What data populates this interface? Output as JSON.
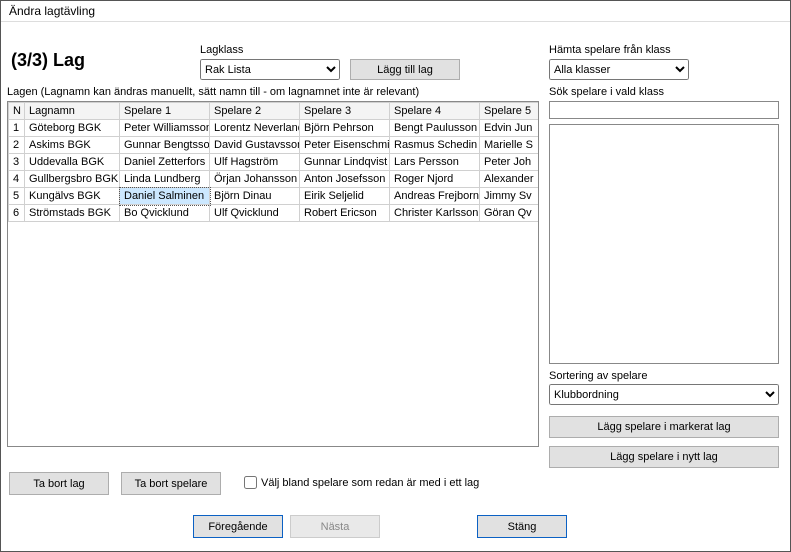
{
  "window": {
    "title": "Ändra lagtävling"
  },
  "page": {
    "step_label": "(3/3) Lag"
  },
  "lagklass": {
    "label": "Lagklass",
    "value": "Rak Lista"
  },
  "lagg_till_lag": "Lägg till lag",
  "hamta": {
    "label": "Hämta spelare från klass",
    "value": "Alla klasser"
  },
  "sok": {
    "label": "Sök spelare i vald klass",
    "value": ""
  },
  "sort": {
    "label": "Sortering av spelare",
    "value": "Klubbordning"
  },
  "btn_lagg_markerat": "Lägg spelare i markerat lag",
  "btn_lagg_nytt": "Lägg spelare i nytt lag",
  "lagen_label": "Lagen (Lagnamn kan ändras manuellt, sätt namn till - om lagnamnet inte är relevant)",
  "table": {
    "cols": [
      "N",
      "Lagnamn",
      "Spelare 1",
      "Spelare 2",
      "Spelare 3",
      "Spelare 4",
      "Spelare 5"
    ],
    "rows": [
      [
        "1",
        "Göteborg BGK",
        "Peter Williamsson",
        "Lorentz Neverland",
        "Björn Pehrson",
        "Bengt Paulusson",
        "Edvin Jun"
      ],
      [
        "2",
        "Askims BGK",
        "Gunnar Bengtsson",
        "David Gustavsson",
        "Peter Eisenschmidt",
        "Rasmus Schedin",
        "Marielle S"
      ],
      [
        "3",
        "Uddevalla BGK",
        "Daniel Zetterfors",
        "Ulf Hagström",
        "Gunnar Lindqvist",
        "Lars Persson",
        "Peter Joh"
      ],
      [
        "4",
        "Gullbergsbro BGK",
        "Linda Lundberg",
        "Örjan Johansson",
        "Anton Josefsson",
        "Roger Njord",
        "Alexander"
      ],
      [
        "5",
        "Kungälvs BGK",
        "Daniel Salminen",
        "Björn Dinau",
        "Eirik Seljelid",
        "Andreas Frejborn",
        "Jimmy Sv"
      ],
      [
        "6",
        "Strömstads BGK",
        "Bo Qvicklund",
        "Ulf Qvicklund",
        "Robert Ericson",
        "Christer Karlsson",
        "Göran Qv"
      ]
    ],
    "selected": {
      "row": 4,
      "col": 2
    }
  },
  "btn_ta_bort_lag": "Ta bort lag",
  "btn_ta_bort_spelare": "Ta bort spelare",
  "chk_label": "Välj bland spelare som redan är med i ett lag",
  "btn_prev": "Föregående",
  "btn_next": "Nästa",
  "btn_close": "Stäng"
}
